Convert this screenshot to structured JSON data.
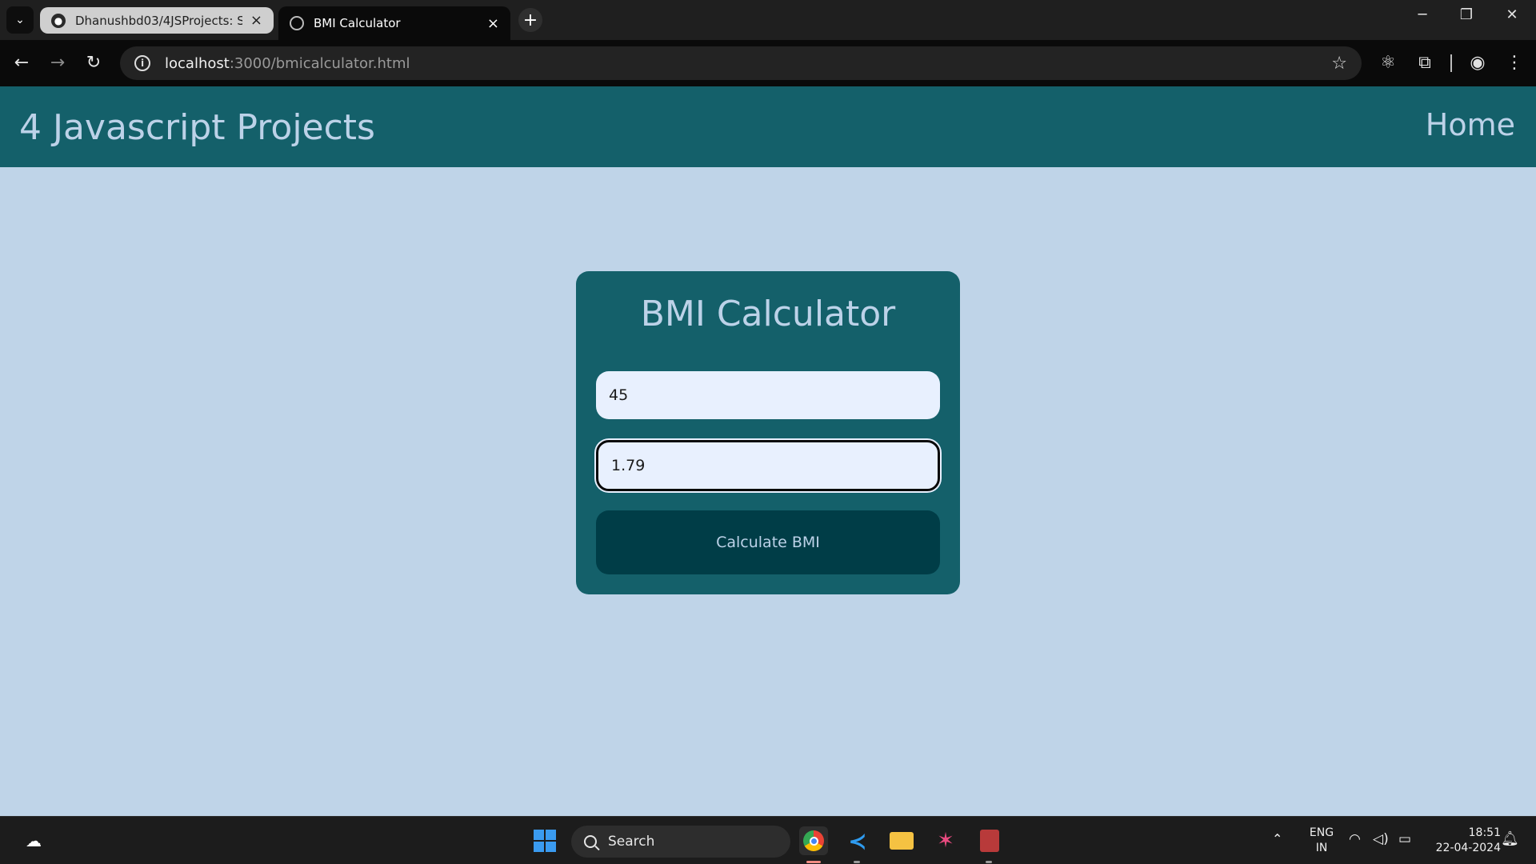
{
  "browser": {
    "tabs": [
      {
        "title": "Dhanushbd03/4JSProjects: Sm",
        "active": false
      },
      {
        "title": "BMI Calculator",
        "active": true
      }
    ],
    "url_host": "localhost",
    "url_path": ":3000/bmicalculator.html"
  },
  "site": {
    "title": "4 Javascript Projects",
    "nav_home": "Home"
  },
  "bmi": {
    "heading": "BMI Calculator",
    "weight_value": "45",
    "height_value": "1.79",
    "button_label": "Calculate BMI"
  },
  "taskbar": {
    "search_label": "Search",
    "lang_line1": "ENG",
    "lang_line2": "IN",
    "time": "18:51",
    "date": "22-04-2024"
  },
  "colors": {
    "page_bg": "#bfd4e8",
    "header_bg": "#14606a",
    "card_bg": "#14606a",
    "button_bg": "#003d47",
    "text_light": "#bcd2e8"
  }
}
